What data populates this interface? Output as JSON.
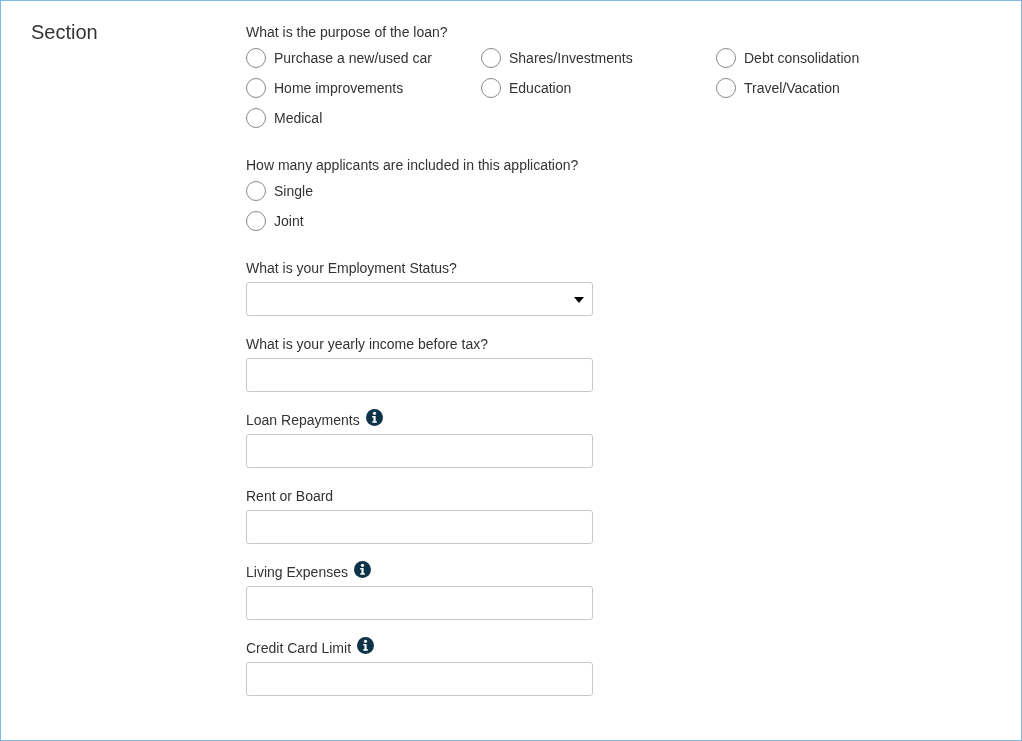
{
  "section_title": "Section",
  "questions": [
    {
      "kind": "radio",
      "label": "What is the purpose of the loan?",
      "options": [
        {
          "label": "Purchase a new/used car",
          "selected": false
        },
        {
          "label": "Shares/Investments",
          "selected": false
        },
        {
          "label": "Debt consolidation",
          "selected": false
        },
        {
          "label": "Home improvements",
          "selected": false
        },
        {
          "label": "Education",
          "selected": false
        },
        {
          "label": "Travel/Vacation",
          "selected": false
        },
        {
          "label": "Medical",
          "selected": false
        }
      ]
    },
    {
      "kind": "radio",
      "label": "How many applicants are included in this application?",
      "options": [
        {
          "label": "Single",
          "selected": false
        },
        {
          "label": "Joint",
          "selected": false
        }
      ]
    },
    {
      "kind": "select",
      "label": "What is your Employment Status?"
    },
    {
      "kind": "text",
      "label": "What is your yearly income before tax?",
      "info": false
    },
    {
      "kind": "text",
      "label": "Loan Repayments",
      "info": true
    },
    {
      "kind": "text",
      "label": "Rent or Board",
      "info": false
    },
    {
      "kind": "text",
      "label": "Living Expenses",
      "info": true
    },
    {
      "kind": "text",
      "label": "Credit Card Limit",
      "info": true
    }
  ]
}
